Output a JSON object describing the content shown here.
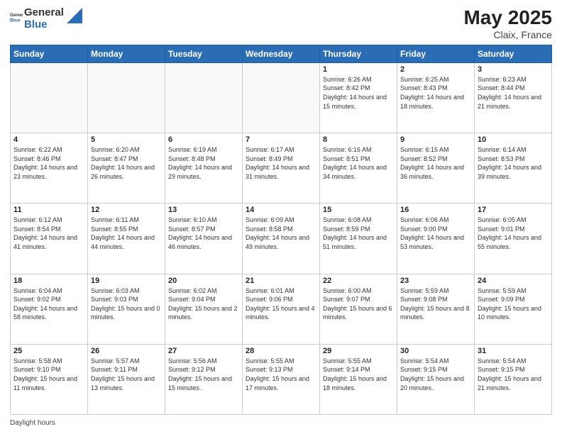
{
  "header": {
    "logo_general": "General",
    "logo_blue": "Blue",
    "title": "May 2025",
    "location": "Claix, France"
  },
  "days_of_week": [
    "Sunday",
    "Monday",
    "Tuesday",
    "Wednesday",
    "Thursday",
    "Friday",
    "Saturday"
  ],
  "weeks": [
    [
      {
        "day": "",
        "info": ""
      },
      {
        "day": "",
        "info": ""
      },
      {
        "day": "",
        "info": ""
      },
      {
        "day": "",
        "info": ""
      },
      {
        "day": "1",
        "info": "Sunrise: 6:26 AM\nSunset: 8:42 PM\nDaylight: 14 hours and 15 minutes."
      },
      {
        "day": "2",
        "info": "Sunrise: 6:25 AM\nSunset: 8:43 PM\nDaylight: 14 hours and 18 minutes."
      },
      {
        "day": "3",
        "info": "Sunrise: 6:23 AM\nSunset: 8:44 PM\nDaylight: 14 hours and 21 minutes."
      }
    ],
    [
      {
        "day": "4",
        "info": "Sunrise: 6:22 AM\nSunset: 8:46 PM\nDaylight: 14 hours and 23 minutes."
      },
      {
        "day": "5",
        "info": "Sunrise: 6:20 AM\nSunset: 8:47 PM\nDaylight: 14 hours and 26 minutes."
      },
      {
        "day": "6",
        "info": "Sunrise: 6:19 AM\nSunset: 8:48 PM\nDaylight: 14 hours and 29 minutes."
      },
      {
        "day": "7",
        "info": "Sunrise: 6:17 AM\nSunset: 8:49 PM\nDaylight: 14 hours and 31 minutes."
      },
      {
        "day": "8",
        "info": "Sunrise: 6:16 AM\nSunset: 8:51 PM\nDaylight: 14 hours and 34 minutes."
      },
      {
        "day": "9",
        "info": "Sunrise: 6:15 AM\nSunset: 8:52 PM\nDaylight: 14 hours and 36 minutes."
      },
      {
        "day": "10",
        "info": "Sunrise: 6:14 AM\nSunset: 8:53 PM\nDaylight: 14 hours and 39 minutes."
      }
    ],
    [
      {
        "day": "11",
        "info": "Sunrise: 6:12 AM\nSunset: 8:54 PM\nDaylight: 14 hours and 41 minutes."
      },
      {
        "day": "12",
        "info": "Sunrise: 6:11 AM\nSunset: 8:55 PM\nDaylight: 14 hours and 44 minutes."
      },
      {
        "day": "13",
        "info": "Sunrise: 6:10 AM\nSunset: 8:57 PM\nDaylight: 14 hours and 46 minutes."
      },
      {
        "day": "14",
        "info": "Sunrise: 6:09 AM\nSunset: 8:58 PM\nDaylight: 14 hours and 49 minutes."
      },
      {
        "day": "15",
        "info": "Sunrise: 6:08 AM\nSunset: 8:59 PM\nDaylight: 14 hours and 51 minutes."
      },
      {
        "day": "16",
        "info": "Sunrise: 6:06 AM\nSunset: 9:00 PM\nDaylight: 14 hours and 53 minutes."
      },
      {
        "day": "17",
        "info": "Sunrise: 6:05 AM\nSunset: 9:01 PM\nDaylight: 14 hours and 55 minutes."
      }
    ],
    [
      {
        "day": "18",
        "info": "Sunrise: 6:04 AM\nSunset: 9:02 PM\nDaylight: 14 hours and 58 minutes."
      },
      {
        "day": "19",
        "info": "Sunrise: 6:03 AM\nSunset: 9:03 PM\nDaylight: 15 hours and 0 minutes."
      },
      {
        "day": "20",
        "info": "Sunrise: 6:02 AM\nSunset: 9:04 PM\nDaylight: 15 hours and 2 minutes."
      },
      {
        "day": "21",
        "info": "Sunrise: 6:01 AM\nSunset: 9:06 PM\nDaylight: 15 hours and 4 minutes."
      },
      {
        "day": "22",
        "info": "Sunrise: 6:00 AM\nSunset: 9:07 PM\nDaylight: 15 hours and 6 minutes."
      },
      {
        "day": "23",
        "info": "Sunrise: 5:59 AM\nSunset: 9:08 PM\nDaylight: 15 hours and 8 minutes."
      },
      {
        "day": "24",
        "info": "Sunrise: 5:59 AM\nSunset: 9:09 PM\nDaylight: 15 hours and 10 minutes."
      }
    ],
    [
      {
        "day": "25",
        "info": "Sunrise: 5:58 AM\nSunset: 9:10 PM\nDaylight: 15 hours and 11 minutes."
      },
      {
        "day": "26",
        "info": "Sunrise: 5:57 AM\nSunset: 9:11 PM\nDaylight: 15 hours and 13 minutes."
      },
      {
        "day": "27",
        "info": "Sunrise: 5:56 AM\nSunset: 9:12 PM\nDaylight: 15 hours and 15 minutes."
      },
      {
        "day": "28",
        "info": "Sunrise: 5:55 AM\nSunset: 9:13 PM\nDaylight: 15 hours and 17 minutes."
      },
      {
        "day": "29",
        "info": "Sunrise: 5:55 AM\nSunset: 9:14 PM\nDaylight: 15 hours and 18 minutes."
      },
      {
        "day": "30",
        "info": "Sunrise: 5:54 AM\nSunset: 9:15 PM\nDaylight: 15 hours and 20 minutes."
      },
      {
        "day": "31",
        "info": "Sunrise: 5:54 AM\nSunset: 9:15 PM\nDaylight: 15 hours and 21 minutes."
      }
    ]
  ],
  "footer": {
    "daylight_label": "Daylight hours"
  }
}
